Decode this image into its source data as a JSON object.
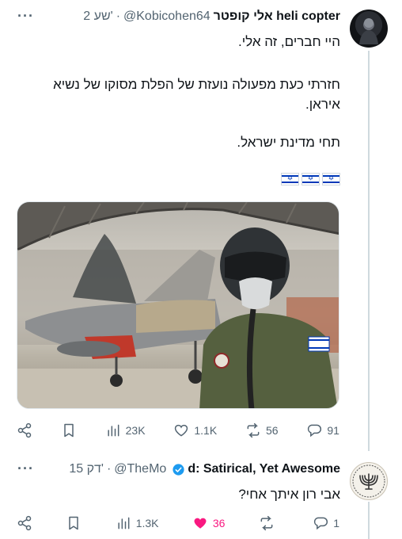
{
  "colors": {
    "text": "#0f1419",
    "muted": "#536471",
    "like": "#f91880",
    "verified": "#1d9bf0",
    "israel_blue": "#0038b8"
  },
  "tweet1": {
    "display_name": "אלי קופטר heli copter",
    "handle": "@Kobicohen64",
    "time": "2 שע'",
    "text_lines": [
      "היי חברים, זה אלי.",
      "חזרתי כעת מפעולה נועזת של הפלת מסוקו של נשיא איראן.",
      "תחי מדינת ישראל."
    ],
    "flags": [
      "🇮🇱",
      "🇮🇱",
      "🇮🇱"
    ],
    "image_alt": "pilot-with-fighter-jet-photo",
    "actions": {
      "views": "23K",
      "likes": "1.1K",
      "reposts": "56",
      "replies": "91"
    },
    "icons": [
      "share-icon",
      "bookmark-icon",
      "views-icon",
      "like-icon",
      "repost-icon",
      "reply-icon"
    ]
  },
  "tweet2": {
    "display_name": "d: Satirical, Yet Awesome",
    "handle": "@TheMo",
    "time": "15 דק'",
    "text": "אבי רון איתך אחי?",
    "actions": {
      "views": "1.3K",
      "likes": "36",
      "reposts": "",
      "replies": "1"
    },
    "icons": [
      "share-icon",
      "bookmark-icon",
      "views-icon",
      "heart-filled-icon",
      "repost-icon",
      "reply-icon"
    ]
  },
  "more_label": "···",
  "dot": "·"
}
